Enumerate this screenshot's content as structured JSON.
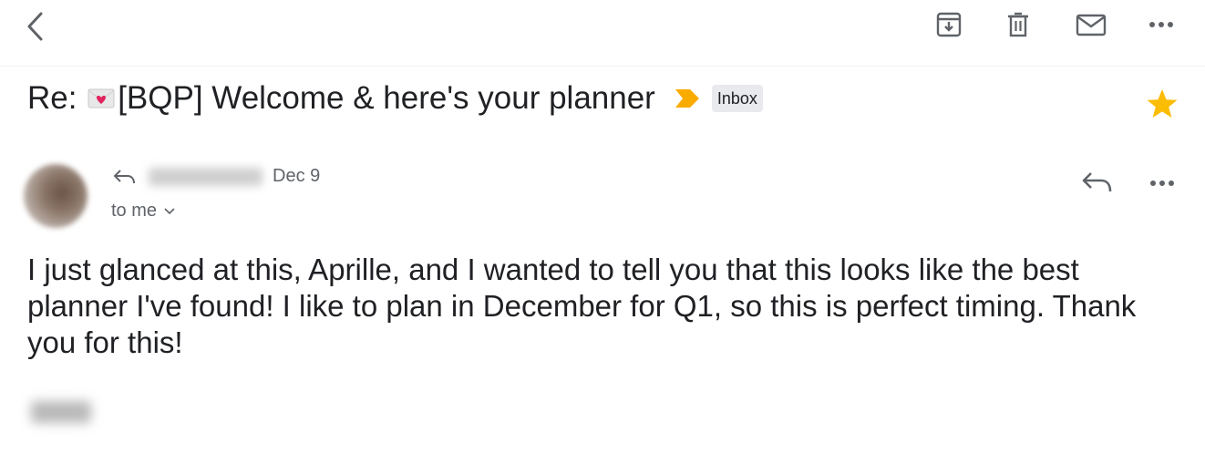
{
  "toolbar": {
    "back_icon": "chevron-left-icon",
    "actions": [
      {
        "name": "archive",
        "icon": "archive-icon"
      },
      {
        "name": "delete",
        "icon": "trash-icon"
      },
      {
        "name": "mark-unread",
        "icon": "mail-icon"
      },
      {
        "name": "more",
        "icon": "more-horizontal-icon"
      }
    ]
  },
  "thread": {
    "subject_prefix": "Re: ",
    "subject_text": "[BQP] Welcome & here's your planner",
    "subject_emoji": "love-letter-icon",
    "label": "Inbox",
    "starred": true,
    "star_color": "#fbbc04",
    "importance_color": "#f9ab00"
  },
  "message": {
    "date": "Dec 9",
    "recipient": "to me",
    "body": "I just glanced at this, Aprille, and I wanted to tell you that this looks like the best planner I've found! I like to plan in December for Q1, so this is perfect timing. Thank you for this!"
  }
}
